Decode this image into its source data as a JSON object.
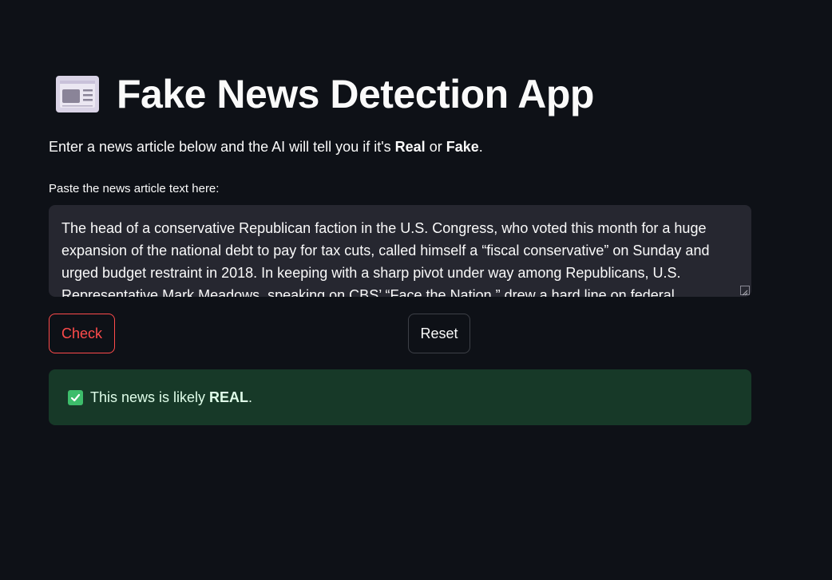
{
  "app": {
    "title": "Fake News Detection App",
    "title_icon": "newspaper-icon"
  },
  "intro": {
    "prefix": "Enter a news article below and the AI will tell you if it's ",
    "real_word": "Real",
    "middle": " or ",
    "fake_word": "Fake",
    "suffix": "."
  },
  "article_input": {
    "label": "Paste the news article text here:",
    "value": "The head of a conservative Republican faction in the U.S. Congress, who voted this month for a huge expansion of the national debt to pay for tax cuts, called himself a “fiscal conservative” on Sunday and urged budget restraint in 2018. In keeping with a sharp pivot under way among Republicans, U.S. Representative Mark Meadows, speaking on CBS’ “Face the Nation,” drew a hard line on federal"
  },
  "buttons": {
    "check_label": "Check",
    "reset_label": "Reset"
  },
  "result": {
    "icon": "check-mark-icon",
    "prefix": "This news is likely ",
    "verdict": "REAL",
    "suffix": "."
  },
  "colors": {
    "background": "#0e1117",
    "input_background": "#262730",
    "primary_accent": "#ff4b4b",
    "success_background": "#173928",
    "success_icon": "#3dbd6b"
  }
}
